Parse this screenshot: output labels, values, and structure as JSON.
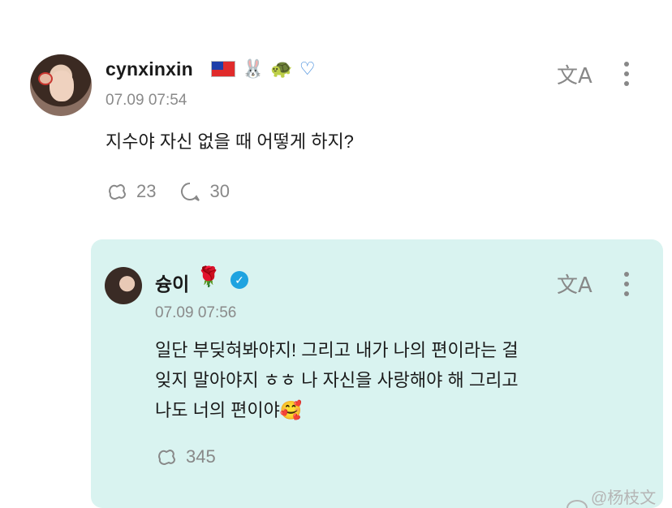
{
  "post": {
    "username": "cynxinxin",
    "badges": [
      "🐰",
      "🐢"
    ],
    "timestamp": "07.09 07:54",
    "text": "지수야 자신 없을 때 어떻게 하지?",
    "repost_count": "23",
    "reply_count": "30",
    "translate_glyph": "文A"
  },
  "reply": {
    "username": "슝이",
    "rose_emoji": "🌹",
    "verified_glyph": "✓",
    "timestamp": "07.09 07:56",
    "text_line1": "일단 부딪혀봐야지! 그리고 내가 나의 편이라는 걸",
    "text_line2": "잊지 말아야지 ㅎㅎ 나 자신을 사랑해야 해 그리고",
    "text_line3": "나도 너의 편이야🥰",
    "repost_count": "345",
    "translate_glyph": "文A"
  },
  "watermark": {
    "text": "@杨枝文暄"
  },
  "colors": {
    "reply_bg": "#d9f3f0",
    "verified": "#1fa3e0",
    "muted": "#8a8a8a"
  }
}
